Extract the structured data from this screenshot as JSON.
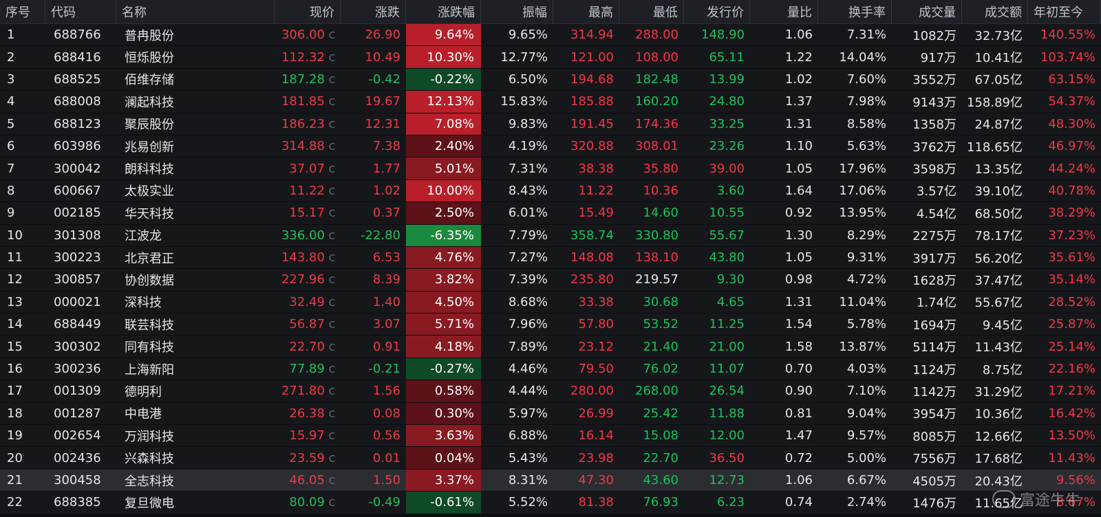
{
  "colors": {
    "up": "#f23645",
    "down": "#18c25a",
    "heat_up_strong": "#b81f2a",
    "heat_up_mid": "#8a1a22",
    "heat_up_weak": "#5c1218",
    "heat_down_strong": "#1b8a3e",
    "heat_down_weak": "#0f4a26"
  },
  "table": {
    "columns": [
      "序号",
      "代码",
      "名称",
      "现价",
      "涨跌",
      "涨跌幅",
      "振幅",
      "最高",
      "最低",
      "发行价",
      "量比",
      "换手率",
      "成交量",
      "成交额",
      "年初至今"
    ],
    "rows": [
      {
        "idx": "1",
        "code": "688766",
        "name": "普冉股份",
        "price": "306.00",
        "price_dir": "up",
        "chg": "26.90",
        "chg_dir": "up",
        "pct": "9.64%",
        "pct_val": 9.64,
        "amp": "9.65%",
        "high": "314.94",
        "high_dir": "up",
        "low": "288.00",
        "low_dir": "up",
        "issue": "148.90",
        "issue_dir": "down",
        "vr": "1.06",
        "turnover": "7.31%",
        "volume": "1082万",
        "amount": "32.73亿",
        "ytd": "140.55%"
      },
      {
        "idx": "2",
        "code": "688416",
        "name": "恒烁股份",
        "price": "112.32",
        "price_dir": "up",
        "chg": "10.49",
        "chg_dir": "up",
        "pct": "10.30%",
        "pct_val": 10.3,
        "amp": "12.77%",
        "high": "121.00",
        "high_dir": "up",
        "low": "108.00",
        "low_dir": "up",
        "issue": "65.11",
        "issue_dir": "down",
        "vr": "1.22",
        "turnover": "14.04%",
        "volume": "917万",
        "amount": "10.41亿",
        "ytd": "103.74%"
      },
      {
        "idx": "3",
        "code": "688525",
        "name": "佰维存储",
        "price": "187.28",
        "price_dir": "down",
        "chg": "-0.42",
        "chg_dir": "down",
        "pct": "-0.22%",
        "pct_val": -0.22,
        "amp": "6.50%",
        "high": "194.68",
        "high_dir": "up",
        "low": "182.48",
        "low_dir": "down",
        "issue": "13.99",
        "issue_dir": "down",
        "vr": "1.02",
        "turnover": "7.60%",
        "volume": "3552万",
        "amount": "67.05亿",
        "ytd": "63.15%"
      },
      {
        "idx": "4",
        "code": "688008",
        "name": "澜起科技",
        "price": "181.85",
        "price_dir": "up",
        "chg": "19.67",
        "chg_dir": "up",
        "pct": "12.13%",
        "pct_val": 12.13,
        "amp": "15.83%",
        "high": "185.88",
        "high_dir": "up",
        "low": "160.20",
        "low_dir": "down",
        "issue": "24.80",
        "issue_dir": "down",
        "vr": "1.37",
        "turnover": "7.98%",
        "volume": "9143万",
        "amount": "158.89亿",
        "ytd": "54.37%"
      },
      {
        "idx": "5",
        "code": "688123",
        "name": "聚辰股份",
        "price": "186.23",
        "price_dir": "up",
        "chg": "12.31",
        "chg_dir": "up",
        "pct": "7.08%",
        "pct_val": 7.08,
        "amp": "9.83%",
        "high": "191.45",
        "high_dir": "up",
        "low": "174.36",
        "low_dir": "up",
        "issue": "33.25",
        "issue_dir": "down",
        "vr": "1.31",
        "turnover": "8.58%",
        "volume": "1358万",
        "amount": "24.87亿",
        "ytd": "48.30%"
      },
      {
        "idx": "6",
        "code": "603986",
        "name": "兆易创新",
        "price": "314.88",
        "price_dir": "up",
        "chg": "7.38",
        "chg_dir": "up",
        "pct": "2.40%",
        "pct_val": 2.4,
        "amp": "4.19%",
        "high": "320.88",
        "high_dir": "up",
        "low": "308.01",
        "low_dir": "up",
        "issue": "23.26",
        "issue_dir": "down",
        "vr": "1.10",
        "turnover": "5.63%",
        "volume": "3762万",
        "amount": "118.65亿",
        "ytd": "46.97%"
      },
      {
        "idx": "7",
        "code": "300042",
        "name": "朗科科技",
        "price": "37.07",
        "price_dir": "up",
        "chg": "1.77",
        "chg_dir": "up",
        "pct": "5.01%",
        "pct_val": 5.01,
        "amp": "7.31%",
        "high": "38.38",
        "high_dir": "up",
        "low": "35.80",
        "low_dir": "up",
        "issue": "39.00",
        "issue_dir": "up",
        "vr": "1.05",
        "turnover": "17.96%",
        "volume": "3598万",
        "amount": "13.35亿",
        "ytd": "44.24%"
      },
      {
        "idx": "8",
        "code": "600667",
        "name": "太极实业",
        "price": "11.22",
        "price_dir": "up",
        "chg": "1.02",
        "chg_dir": "up",
        "pct": "10.00%",
        "pct_val": 10.0,
        "amp": "8.43%",
        "high": "11.22",
        "high_dir": "up",
        "low": "10.36",
        "low_dir": "up",
        "issue": "3.60",
        "issue_dir": "down",
        "vr": "1.64",
        "turnover": "17.06%",
        "volume": "3.57亿",
        "amount": "39.10亿",
        "ytd": "40.78%"
      },
      {
        "idx": "9",
        "code": "002185",
        "name": "华天科技",
        "price": "15.17",
        "price_dir": "up",
        "chg": "0.37",
        "chg_dir": "up",
        "pct": "2.50%",
        "pct_val": 2.5,
        "amp": "6.01%",
        "high": "15.49",
        "high_dir": "up",
        "low": "14.60",
        "low_dir": "down",
        "issue": "10.55",
        "issue_dir": "down",
        "vr": "0.92",
        "turnover": "13.95%",
        "volume": "4.54亿",
        "amount": "68.50亿",
        "ytd": "38.29%"
      },
      {
        "idx": "10",
        "code": "301308",
        "name": "江波龙",
        "price": "336.00",
        "price_dir": "down",
        "chg": "-22.80",
        "chg_dir": "down",
        "pct": "-6.35%",
        "pct_val": -6.35,
        "amp": "7.79%",
        "high": "358.74",
        "high_dir": "down",
        "low": "330.80",
        "low_dir": "down",
        "issue": "55.67",
        "issue_dir": "down",
        "vr": "1.30",
        "turnover": "8.29%",
        "volume": "2275万",
        "amount": "78.17亿",
        "ytd": "37.23%"
      },
      {
        "idx": "11",
        "code": "300223",
        "name": "北京君正",
        "price": "143.80",
        "price_dir": "up",
        "chg": "6.53",
        "chg_dir": "up",
        "pct": "4.76%",
        "pct_val": 4.76,
        "amp": "7.27%",
        "high": "148.08",
        "high_dir": "up",
        "low": "138.10",
        "low_dir": "up",
        "issue": "43.80",
        "issue_dir": "down",
        "vr": "1.05",
        "turnover": "9.31%",
        "volume": "3917万",
        "amount": "56.20亿",
        "ytd": "35.61%"
      },
      {
        "idx": "12",
        "code": "300857",
        "name": "协创数据",
        "price": "227.96",
        "price_dir": "up",
        "chg": "8.39",
        "chg_dir": "up",
        "pct": "3.82%",
        "pct_val": 3.82,
        "amp": "7.39%",
        "high": "235.80",
        "high_dir": "up",
        "low": "219.57",
        "low_dir": "flat",
        "issue": "9.30",
        "issue_dir": "down",
        "vr": "0.98",
        "turnover": "4.72%",
        "volume": "1628万",
        "amount": "37.47亿",
        "ytd": "35.14%"
      },
      {
        "idx": "13",
        "code": "000021",
        "name": "深科技",
        "price": "32.49",
        "price_dir": "up",
        "chg": "1.40",
        "chg_dir": "up",
        "pct": "4.50%",
        "pct_val": 4.5,
        "amp": "8.68%",
        "high": "33.38",
        "high_dir": "up",
        "low": "30.68",
        "low_dir": "down",
        "issue": "4.65",
        "issue_dir": "down",
        "vr": "1.31",
        "turnover": "11.04%",
        "volume": "1.74亿",
        "amount": "55.67亿",
        "ytd": "28.52%"
      },
      {
        "idx": "14",
        "code": "688449",
        "name": "联芸科技",
        "price": "56.87",
        "price_dir": "up",
        "chg": "3.07",
        "chg_dir": "up",
        "pct": "5.71%",
        "pct_val": 5.71,
        "amp": "7.96%",
        "high": "57.80",
        "high_dir": "up",
        "low": "53.52",
        "low_dir": "down",
        "issue": "11.25",
        "issue_dir": "down",
        "vr": "1.54",
        "turnover": "5.78%",
        "volume": "1694万",
        "amount": "9.45亿",
        "ytd": "25.87%"
      },
      {
        "idx": "15",
        "code": "300302",
        "name": "同有科技",
        "price": "22.70",
        "price_dir": "up",
        "chg": "0.91",
        "chg_dir": "up",
        "pct": "4.18%",
        "pct_val": 4.18,
        "amp": "7.89%",
        "high": "23.12",
        "high_dir": "up",
        "low": "21.40",
        "low_dir": "down",
        "issue": "21.00",
        "issue_dir": "down",
        "vr": "1.58",
        "turnover": "13.87%",
        "volume": "5114万",
        "amount": "11.43亿",
        "ytd": "25.14%"
      },
      {
        "idx": "16",
        "code": "300236",
        "name": "上海新阳",
        "price": "77.89",
        "price_dir": "down",
        "chg": "-0.21",
        "chg_dir": "down",
        "pct": "-0.27%",
        "pct_val": -0.27,
        "amp": "4.46%",
        "high": "79.50",
        "high_dir": "up",
        "low": "76.02",
        "low_dir": "down",
        "issue": "11.07",
        "issue_dir": "down",
        "vr": "0.70",
        "turnover": "4.03%",
        "volume": "1124万",
        "amount": "8.75亿",
        "ytd": "22.16%"
      },
      {
        "idx": "17",
        "code": "001309",
        "name": "德明利",
        "price": "271.80",
        "price_dir": "up",
        "chg": "1.56",
        "chg_dir": "up",
        "pct": "0.58%",
        "pct_val": 0.58,
        "amp": "4.44%",
        "high": "280.00",
        "high_dir": "up",
        "low": "268.00",
        "low_dir": "down",
        "issue": "26.54",
        "issue_dir": "down",
        "vr": "0.90",
        "turnover": "7.10%",
        "volume": "1142万",
        "amount": "31.29亿",
        "ytd": "17.21%"
      },
      {
        "idx": "18",
        "code": "001287",
        "name": "中电港",
        "price": "26.38",
        "price_dir": "up",
        "chg": "0.08",
        "chg_dir": "up",
        "pct": "0.30%",
        "pct_val": 0.3,
        "amp": "5.97%",
        "high": "26.99",
        "high_dir": "up",
        "low": "25.42",
        "low_dir": "down",
        "issue": "11.88",
        "issue_dir": "down",
        "vr": "0.81",
        "turnover": "9.04%",
        "volume": "3954万",
        "amount": "10.36亿",
        "ytd": "16.42%"
      },
      {
        "idx": "19",
        "code": "002654",
        "name": "万润科技",
        "price": "15.97",
        "price_dir": "up",
        "chg": "0.56",
        "chg_dir": "up",
        "pct": "3.63%",
        "pct_val": 3.63,
        "amp": "6.88%",
        "high": "16.14",
        "high_dir": "up",
        "low": "15.08",
        "low_dir": "down",
        "issue": "12.00",
        "issue_dir": "down",
        "vr": "1.47",
        "turnover": "9.57%",
        "volume": "8085万",
        "amount": "12.66亿",
        "ytd": "13.50%"
      },
      {
        "idx": "20",
        "code": "002436",
        "name": "兴森科技",
        "price": "23.59",
        "price_dir": "up",
        "chg": "0.01",
        "chg_dir": "up",
        "pct": "0.04%",
        "pct_val": 0.04,
        "amp": "5.43%",
        "high": "23.98",
        "high_dir": "up",
        "low": "22.70",
        "low_dir": "down",
        "issue": "36.50",
        "issue_dir": "up",
        "vr": "0.72",
        "turnover": "5.00%",
        "volume": "7556万",
        "amount": "17.68亿",
        "ytd": "11.43%"
      },
      {
        "idx": "21",
        "code": "300458",
        "name": "全志科技",
        "price": "46.05",
        "price_dir": "up",
        "chg": "1.50",
        "chg_dir": "up",
        "pct": "3.37%",
        "pct_val": 3.37,
        "amp": "8.31%",
        "high": "47.30",
        "high_dir": "up",
        "low": "43.60",
        "low_dir": "down",
        "issue": "12.73",
        "issue_dir": "down",
        "vr": "1.06",
        "turnover": "6.67%",
        "volume": "4505万",
        "amount": "20.43亿",
        "ytd": "9.56%",
        "selected": true
      },
      {
        "idx": "22",
        "code": "688385",
        "name": "复旦微电",
        "price": "80.09",
        "price_dir": "down",
        "chg": "-0.49",
        "chg_dir": "down",
        "pct": "-0.61%",
        "pct_val": -0.61,
        "amp": "5.52%",
        "high": "81.38",
        "high_dir": "up",
        "low": "76.93",
        "low_dir": "down",
        "issue": "6.23",
        "issue_dir": "down",
        "vr": "0.74",
        "turnover": "2.74%",
        "volume": "1476万",
        "amount": "11.65亿",
        "ytd": "8.67%"
      }
    ]
  },
  "price_flag": "C",
  "watermark": {
    "text": "富途牛牛"
  }
}
